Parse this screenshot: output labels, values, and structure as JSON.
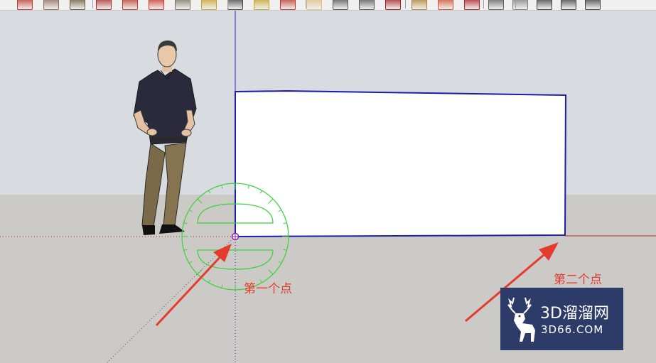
{
  "toolbar": {
    "tools": [
      {
        "name": "select-tool-icon",
        "color": "#c0392b"
      },
      {
        "name": "eraser-tool-icon",
        "color": "#8e6a5a"
      },
      {
        "name": "paint-bucket-icon",
        "color": "#6b5a3a"
      },
      {
        "name": "push-pull-icon",
        "color": "#b02a2a"
      },
      {
        "name": "move-tool-icon",
        "color": "#c0392b"
      },
      {
        "name": "rotate-tool-icon",
        "color": "#d0342c"
      },
      {
        "name": "offset-tool-icon",
        "color": "#7a7060"
      },
      {
        "name": "tape-measure-icon",
        "color": "#c9a227"
      },
      {
        "name": "text-tool-icon",
        "color": "#444444"
      },
      {
        "name": "axes-tool-icon",
        "color": "#c9a227"
      },
      {
        "name": "orbit-tool-icon",
        "color": "#c0392b"
      },
      {
        "name": "pan-tool-icon",
        "color": "#e0c080"
      },
      {
        "name": "zoom-tool-icon",
        "color": "#555555"
      },
      {
        "name": "zoom-extents-icon",
        "color": "#555555"
      },
      {
        "name": "previous-view-icon",
        "color": "#a02020"
      },
      {
        "name": "next-view-icon",
        "color": "#b08030"
      },
      {
        "name": "3d-warehouse-icon",
        "color": "#d05030"
      },
      {
        "name": "component-icon",
        "color": "#b02020"
      },
      {
        "name": "iso-view-icon",
        "color": "#606060"
      },
      {
        "name": "top-view-icon",
        "color": "#808080"
      },
      {
        "name": "front-view-icon",
        "color": "#404040"
      },
      {
        "name": "right-view-icon",
        "color": "#404040"
      },
      {
        "name": "back-view-icon",
        "color": "#404040"
      }
    ]
  },
  "viewport": {
    "sky_color": "#d8dce0",
    "ground_color": "#cccac6",
    "rectangle_fill": "#ffffff",
    "rectangle_edge_color": "#1c1ca8",
    "protractor_color": "#3ad13a",
    "red_axis_color": "#cc2222",
    "blue_axis_color": "#2222cc",
    "green_axis_color": "#22aa22"
  },
  "annotations": {
    "first_point": "第一个点",
    "second_point": "第二个点",
    "arrow_color": "#e53b2f"
  },
  "watermark": {
    "title": "3D溜溜网",
    "subtitle": "3D66.COM",
    "background": "#2d3b69"
  }
}
